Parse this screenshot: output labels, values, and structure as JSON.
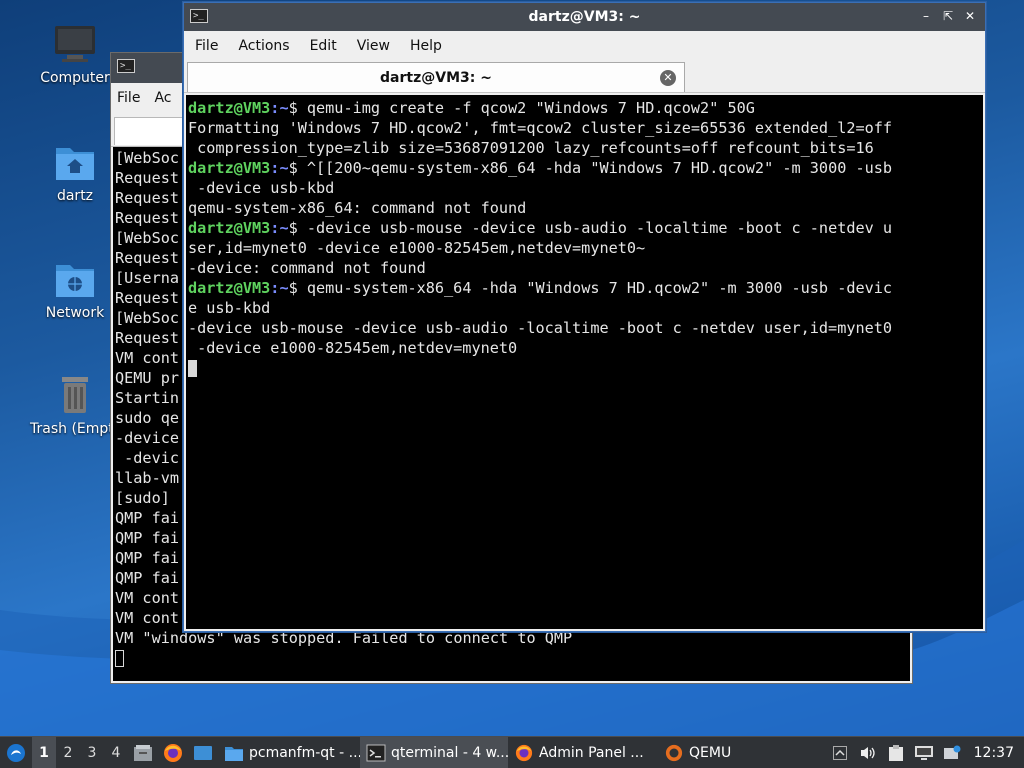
{
  "desktop": {
    "icons": [
      {
        "label": "Computer"
      },
      {
        "label": "dartz"
      },
      {
        "label": "Network"
      },
      {
        "label": "Trash (Empty)"
      }
    ]
  },
  "back_window": {
    "menu": [
      "File",
      "Ac"
    ],
    "lines": [
      "[WebSoc",
      "Request",
      "Request",
      "Request",
      "[WebSoc",
      "Request",
      "[Userna",
      "Request",
      "[WebSoc",
      "Request",
      "VM cont",
      "QEMU pr",
      "Startin",
      "sudo qe",
      "-device",
      " -devic",
      "llab-vm",
      "[sudo] ",
      "QMP fai",
      "QMP fai",
      "QMP fai",
      "QMP fai",
      "VM cont",
      "VM cont",
      "VM \"windows\" was stopped. Failed to connect to QMP"
    ]
  },
  "front_window": {
    "title": "dartz@VM3: ~",
    "menu": [
      "File",
      "Actions",
      "Edit",
      "View",
      "Help"
    ],
    "tab_label": "dartz@VM3: ~",
    "prompt_user": "dartz@VM3",
    "prompt_path": ":~",
    "lines": [
      {
        "type": "prompt",
        "text": "$ qemu-img create -f qcow2 \"Windows 7 HD.qcow2\" 50G"
      },
      {
        "type": "out",
        "text": "Formatting 'Windows 7 HD.qcow2', fmt=qcow2 cluster_size=65536 extended_l2=off"
      },
      {
        "type": "out",
        "text": " compression_type=zlib size=53687091200 lazy_refcounts=off refcount_bits=16"
      },
      {
        "type": "prompt",
        "text": "$ ^[[200~qemu-system-x86_64 -hda \"Windows 7 HD.qcow2\" -m 3000 -usb"
      },
      {
        "type": "out",
        "text": " -device usb-kbd"
      },
      {
        "type": "out",
        "text": "qemu-system-x86_64: command not found"
      },
      {
        "type": "prompt",
        "text": "$ -device usb-mouse -device usb-audio -localtime -boot c -netdev u"
      },
      {
        "type": "out",
        "text": "ser,id=mynet0 -device e1000-82545em,netdev=mynet0~"
      },
      {
        "type": "out",
        "text": "-device: command not found"
      },
      {
        "type": "prompt",
        "text": "$ qemu-system-x86_64 -hda \"Windows 7 HD.qcow2\" -m 3000 -usb -devic"
      },
      {
        "type": "out",
        "text": "e usb-kbd"
      },
      {
        "type": "out",
        "text": "-device usb-mouse -device usb-audio -localtime -boot c -netdev user,id=mynet0"
      },
      {
        "type": "out",
        "text": " -device e1000-82545em,netdev=mynet0"
      }
    ]
  },
  "taskbar": {
    "workspaces": [
      "1",
      "2",
      "3",
      "4"
    ],
    "tasks": [
      {
        "label": "pcmanfm-qt - ...",
        "icon": "folder-icon"
      },
      {
        "label": "qterminal - 4 w...",
        "icon": "terminal-icon"
      },
      {
        "label": "Admin Panel ...",
        "icon": "firefox-icon"
      },
      {
        "label": "QEMU",
        "icon": "qemu-icon"
      }
    ],
    "clock": "12:37"
  },
  "colors": {
    "prompt_user": "#5fd35f",
    "prompt_path": "#7b8dff",
    "titlebar": "#444a52",
    "taskbar": "#2f3236"
  }
}
